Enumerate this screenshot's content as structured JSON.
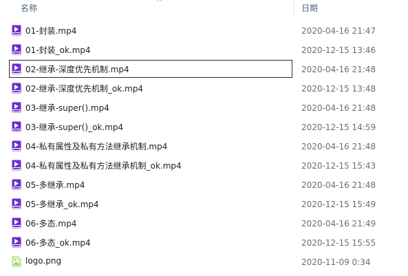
{
  "header": {
    "name_label": "名称",
    "date_label": "日期",
    "sort_indicator": "^"
  },
  "files": [
    {
      "name": "01-封装.mp4",
      "date": "2020-04-16 21:47",
      "icon": "mp4-file-icon",
      "selected": false
    },
    {
      "name": "01-封装_ok.mp4",
      "date": "2020-12-15 13:46",
      "icon": "mp4-file-icon",
      "selected": false
    },
    {
      "name": "02-继承-深度优先机制.mp4",
      "date": "2020-04-16 21:48",
      "icon": "mp4-file-icon",
      "selected": true
    },
    {
      "name": "02-继承-深度优先机制_ok.mp4",
      "date": "2020-12-15 13:48",
      "icon": "mp4-file-icon",
      "selected": false
    },
    {
      "name": "03-继承-super().mp4",
      "date": "2020-04-16 21:48",
      "icon": "mp4-file-icon",
      "selected": false
    },
    {
      "name": "03-继承-super()_ok.mp4",
      "date": "2020-12-15 14:59",
      "icon": "mp4-file-icon",
      "selected": false
    },
    {
      "name": "04-私有属性及私有方法继承机制.mp4",
      "date": "2020-04-16 21:48",
      "icon": "mp4-file-icon",
      "selected": false
    },
    {
      "name": "04-私有属性及私有方法继承机制_ok.mp4",
      "date": "2020-12-15 15:43",
      "icon": "mp4-file-icon",
      "selected": false
    },
    {
      "name": "05-多继承.mp4",
      "date": "2020-04-16 21:48",
      "icon": "mp4-file-icon",
      "selected": false
    },
    {
      "name": "05-多继承_ok.mp4",
      "date": "2020-12-15 15:49",
      "icon": "mp4-file-icon",
      "selected": false
    },
    {
      "name": "06-多态.mp4",
      "date": "2020-04-16 21:49",
      "icon": "mp4-file-icon",
      "selected": false
    },
    {
      "name": "06-多态_ok.mp4",
      "date": "2020-12-15 15:55",
      "icon": "mp4-file-icon",
      "selected": false
    },
    {
      "name": "logo.png",
      "date": "2020-11-09 0:34",
      "icon": "png-file-icon",
      "selected": false
    }
  ],
  "colors": {
    "header_text": "#4c607a",
    "date_text": "#6d6d6d",
    "mp4_icon": "#6a2fc9",
    "png_icon": "#9ccc65"
  }
}
